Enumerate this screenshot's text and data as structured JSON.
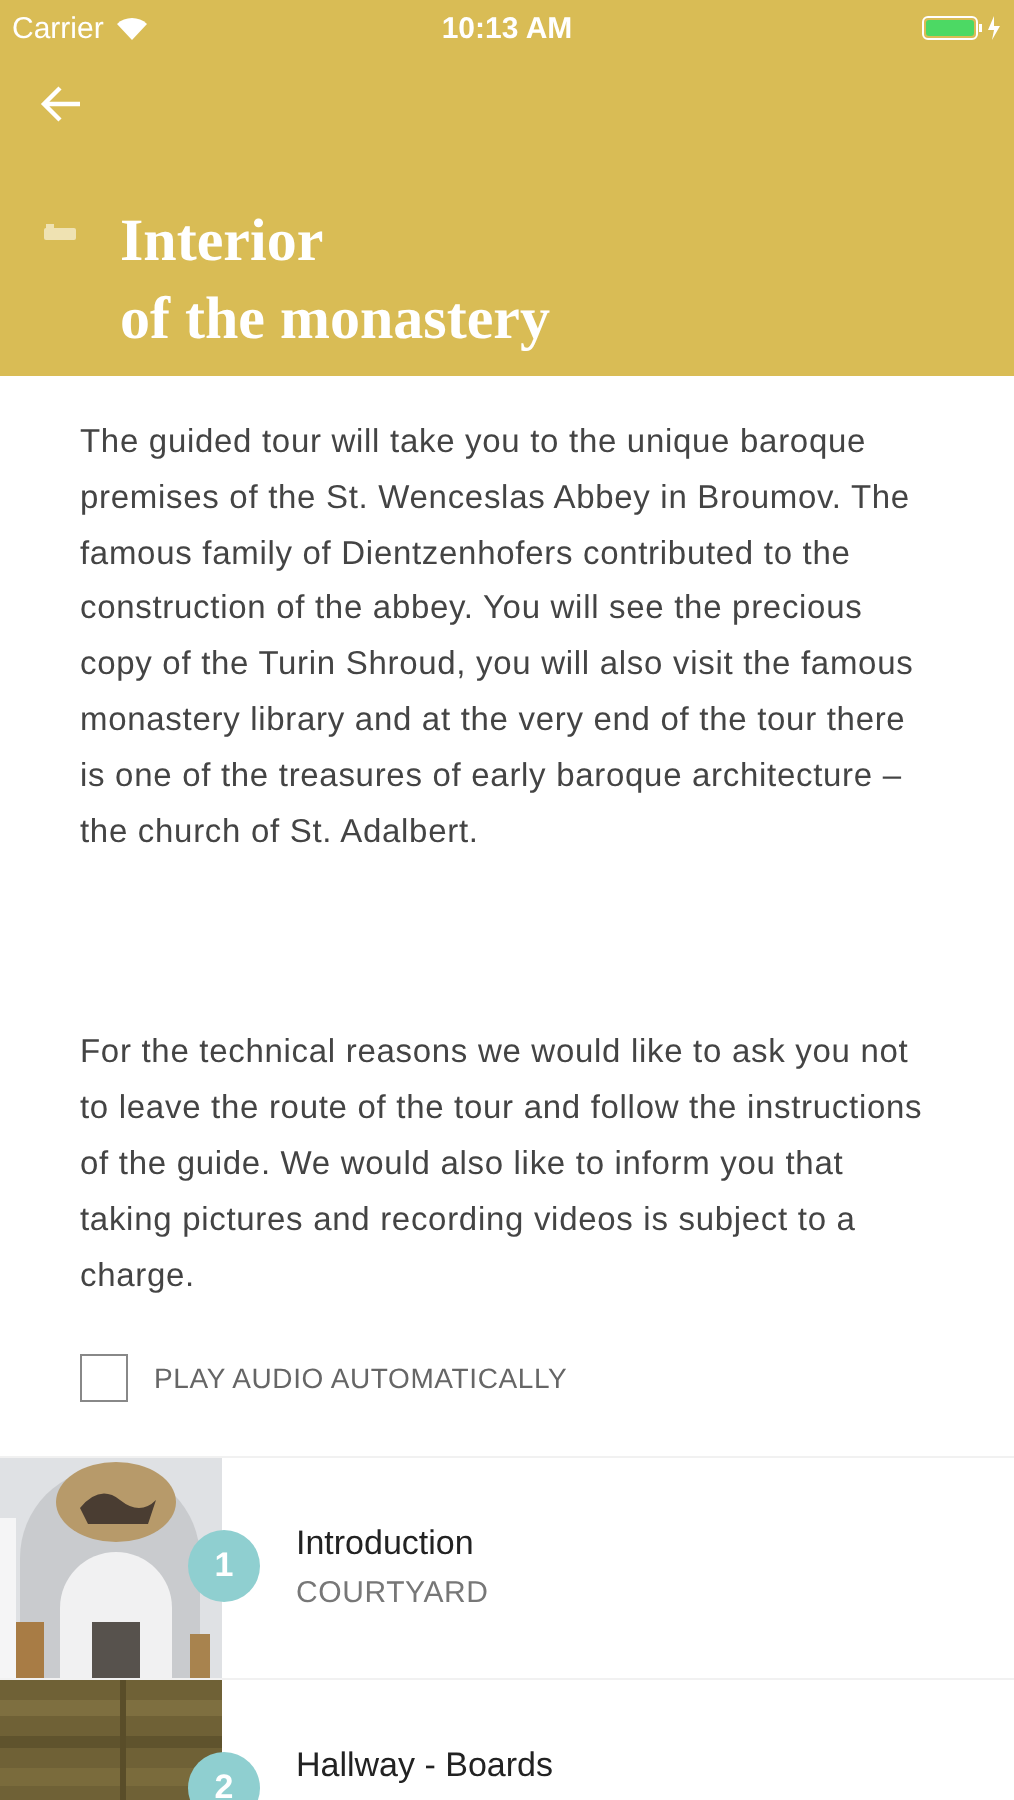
{
  "status_bar": {
    "carrier": "Carrier",
    "time": "10:13 AM"
  },
  "header": {
    "title_lines": [
      "Interior",
      "of the monastery"
    ]
  },
  "paragraphs": [
    "The guided tour will take you to the unique baroque premises of the St. Wenceslas Abbey in Broumov. The famous family of Dientzenhofers contributed to the construction of the abbey. You will see the precious copy of the Turin Shroud, you will also visit the famous monastery library and at the very end of the tour there is one of the treasures of early baroque architecture – the church of St. Adalbert.",
    "For the technical reasons we would like to ask you not to leave the route of the tour and follow the instructions of the guide. We would also like to inform you that taking pictures and recording videos is subject to a charge."
  ],
  "autoplay": {
    "label": "PLAY AUDIO AUTOMATICALLY",
    "checked": false
  },
  "stops": [
    {
      "number": "1",
      "title": "Introduction",
      "subtitle": "COURTYARD"
    },
    {
      "number": "2",
      "title": "Hallway - Boards"
    }
  ]
}
